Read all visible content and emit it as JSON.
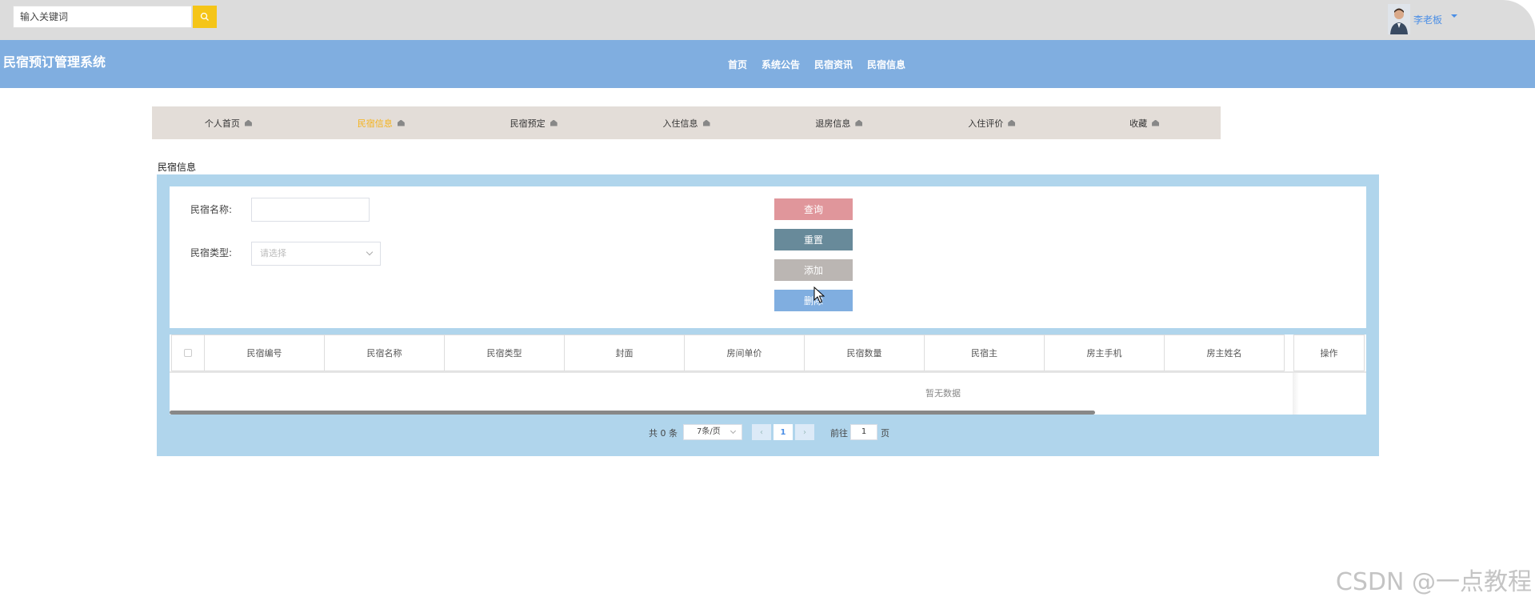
{
  "topbar": {
    "search_placeholder": "输入关键词",
    "search_icon": "search-icon",
    "user_name": "李老板",
    "accent": "#f5c518"
  },
  "header": {
    "site_title": "民宿预订管理系统",
    "nav": [
      "首页",
      "系统公告",
      "民宿资讯",
      "民宿信息"
    ],
    "bg_color": "#80aee0"
  },
  "tabs": [
    {
      "label": "个人首页",
      "active": false
    },
    {
      "label": "民宿信息",
      "active": true
    },
    {
      "label": "民宿预定",
      "active": false
    },
    {
      "label": "入住信息",
      "active": false
    },
    {
      "label": "退房信息",
      "active": false
    },
    {
      "label": "入住评价",
      "active": false
    },
    {
      "label": "收藏",
      "active": false
    }
  ],
  "section_label": "民宿信息",
  "filters": {
    "name_label": "民宿名称:",
    "name_value": "",
    "type_label": "民宿类型:",
    "type_placeholder": "请选择"
  },
  "actions": {
    "query": "查询",
    "reset": "重置",
    "add": "添加",
    "delete": "删除",
    "query_color": "#e0969b",
    "reset_color": "#688a9a",
    "add_color": "#bbb6b3",
    "delete_color": "#80aee0"
  },
  "table": {
    "columns": [
      "民宿编号",
      "民宿名称",
      "民宿类型",
      "封面",
      "房间单价",
      "民宿数量",
      "民宿主",
      "房主手机",
      "房主姓名",
      "操作"
    ],
    "empty_text": "暂无数据"
  },
  "pagination": {
    "total": "共 0 条",
    "page_size": "7条/页",
    "current_page": "1",
    "goto_label": "前往",
    "goto_value": "1",
    "unit": "页"
  },
  "watermark": "CSDN @一点教程"
}
